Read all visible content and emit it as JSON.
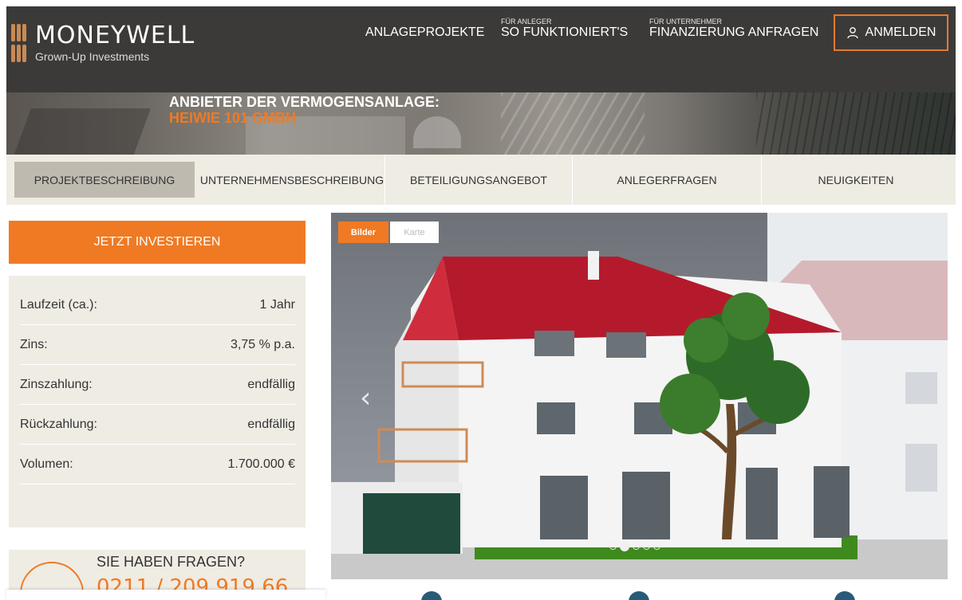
{
  "header": {
    "brand": "MONEYWELL",
    "tagline": "Grown-Up Investments",
    "nav": [
      {
        "small": "",
        "label": "ANLAGEPROJEKTE"
      },
      {
        "small": "FÜR ANLEGER",
        "label": "SO FUNKTIONIERT'S"
      },
      {
        "small": "FÜR UNTERNEHMER",
        "label": "FINANZIERUNG ANFRAGEN"
      }
    ],
    "login_label": "ANMELDEN"
  },
  "hero": {
    "line1": "ANBIETER DER VERMOGENSANLAGE:",
    "line2": "HEIWIE 101 GMBH"
  },
  "tabs": [
    {
      "label": "PROJEKTBESCHREIBUNG",
      "active": true
    },
    {
      "label": "UNTERNEHMENSBESCHREIBUNG",
      "active": false
    },
    {
      "label": "BETEILIGUNGSANGEBOT",
      "active": false
    },
    {
      "label": "ANLEGERFRAGEN",
      "active": false
    },
    {
      "label": "NEUIGKEITEN",
      "active": false
    }
  ],
  "invest_label": "JETZT INVESTIEREN",
  "facts": [
    {
      "label": "Laufzeit (ca.):",
      "value": "1 Jahr"
    },
    {
      "label": "Zins:",
      "value": "3,75 % p.a."
    },
    {
      "label": "Zinszahlung:",
      "value": "endfällig"
    },
    {
      "label": "Rückzahlung:",
      "value": "endfällig"
    },
    {
      "label": "Volumen:",
      "value": "1.700.000 €"
    }
  ],
  "contact": {
    "question": "SIE HABEN FRAGEN?",
    "phone": "0211 / 209 919 66"
  },
  "gallery": {
    "tab_images": "Bilder",
    "tab_map": "Karte",
    "prev_glyph": "‹",
    "dots_count": 5,
    "active_dot": 1
  },
  "colors": {
    "accent": "#f07a23",
    "header_bg": "#3b3a39",
    "panel_bg": "#efece4"
  }
}
